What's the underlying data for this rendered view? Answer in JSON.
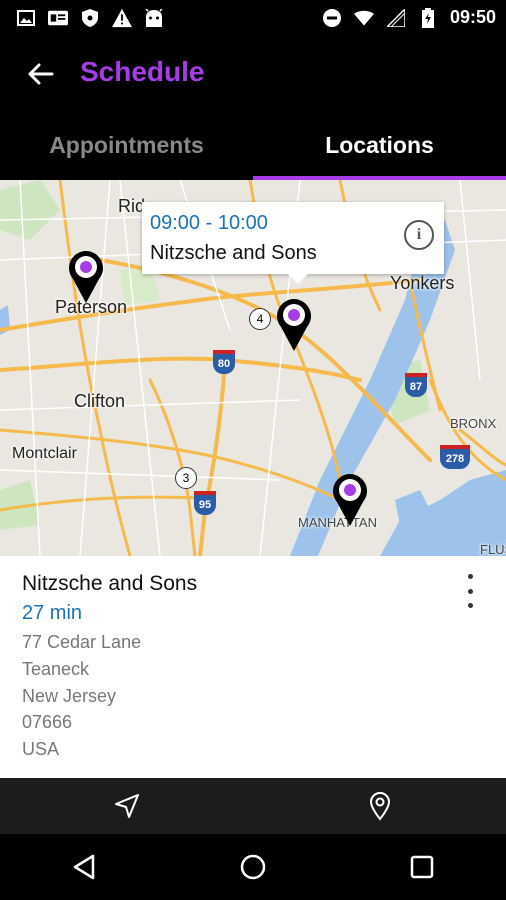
{
  "status_bar": {
    "time": "09:50",
    "icons_left": [
      "image-icon",
      "card-icon",
      "shield-icon",
      "warning-icon",
      "android-icon"
    ],
    "icons_right": [
      "do-not-disturb-icon",
      "wifi-icon",
      "signal-icon",
      "battery-icon"
    ]
  },
  "app_bar": {
    "title": "Schedule",
    "back_icon": "arrow-back-icon"
  },
  "tabs": [
    {
      "label": "Appointments",
      "active": false
    },
    {
      "label": "Locations",
      "active": true
    }
  ],
  "map": {
    "labels": {
      "paterson": "Paterson",
      "clifton": "Clifton",
      "montclair": "Montclair",
      "yonkers": "Yonkers",
      "ridgewood_partial": "Rid",
      "bronx": "BRONX",
      "manhattan": "MANHATTAN",
      "flushing_partial": "FLUS"
    },
    "routes": {
      "r4": "4",
      "r3": "3",
      "i80": "80",
      "i95": "95",
      "i87": "87",
      "i278": "278"
    },
    "info_window": {
      "time": "09:00 - 10:00",
      "name": "Nitzsche and Sons",
      "info_glyph": "i"
    }
  },
  "detail": {
    "name": "Nitzsche and Sons",
    "duration": "27 min",
    "street": "77 Cedar Lane",
    "city": "Teaneck",
    "state": "New Jersey",
    "zip": "07666",
    "country": "USA"
  },
  "bottom_nav": [
    {
      "icon": "navigation-icon"
    },
    {
      "icon": "location-pin-icon"
    }
  ],
  "colors": {
    "accent": "#a63ce8",
    "link_blue": "#1a73b8",
    "map_bg": "#eae7e0",
    "water": "#9ec3ea",
    "highway": "#f6b94c"
  }
}
